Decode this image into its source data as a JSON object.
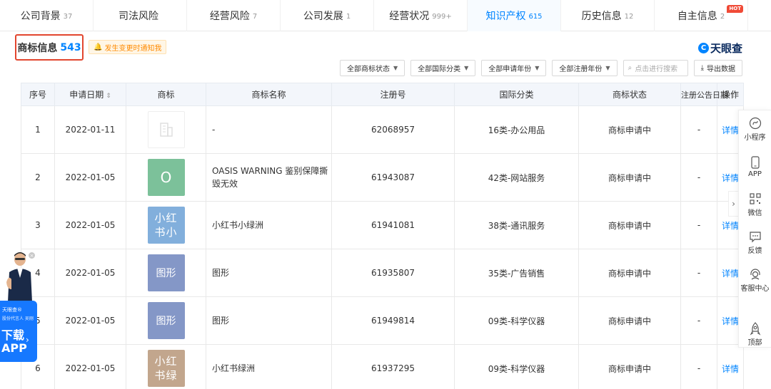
{
  "tabs": [
    {
      "label": "公司背景",
      "count": "37",
      "active": false
    },
    {
      "label": "司法风险",
      "count": "",
      "active": false
    },
    {
      "label": "经营风险",
      "count": "7",
      "active": false
    },
    {
      "label": "公司发展",
      "count": "1",
      "active": false
    },
    {
      "label": "经营状况",
      "count": "999+",
      "active": false
    },
    {
      "label": "知识产权",
      "count": "615",
      "active": true
    },
    {
      "label": "历史信息",
      "count": "12",
      "active": false
    },
    {
      "label": "自主信息",
      "count": "2",
      "active": false,
      "badge": "HOT"
    }
  ],
  "section": {
    "title": "商标信息",
    "count": "543",
    "notify": "发生变更时通知我",
    "logo": "天眼查"
  },
  "filters": {
    "status": "全部商标状态",
    "intl_class": "全部国际分类",
    "apply_year": "全部申请年份",
    "reg_year": "全部注册年份",
    "search_placeholder": "点击进行搜索",
    "export": "导出数据"
  },
  "table": {
    "headers": [
      "序号",
      "申请日期",
      "商标",
      "商标名称",
      "注册号",
      "国际分类",
      "商标状态",
      "注册公告日期",
      "操作"
    ],
    "rows": [
      {
        "no": "1",
        "date": "2022-01-11",
        "tm_text": "",
        "tm_color": "#ffffff",
        "name": "-",
        "reg_no": "62068957",
        "class": "16类-办公用品",
        "status": "商标申请中",
        "pub_date": "-",
        "op": "详情"
      },
      {
        "no": "2",
        "date": "2022-01-05",
        "tm_text": "O",
        "tm_color": "#7cc19a",
        "name": "OASIS WARNING 鉴别保障撕毁无效",
        "reg_no": "61943087",
        "class": "42类-网站服务",
        "status": "商标申请中",
        "pub_date": "-",
        "op": "详情"
      },
      {
        "no": "3",
        "date": "2022-01-05",
        "tm_text": "小红书小",
        "tm_color": "#82afdc",
        "name": "小红书小绿洲",
        "reg_no": "61941081",
        "class": "38类-通讯服务",
        "status": "商标申请中",
        "pub_date": "-",
        "op": "详情"
      },
      {
        "no": "4",
        "date": "2022-01-05",
        "tm_text": "图形",
        "tm_color": "#8497c7",
        "name": "图形",
        "reg_no": "61935807",
        "class": "35类-广告销售",
        "status": "商标申请中",
        "pub_date": "-",
        "op": "详情"
      },
      {
        "no": "5",
        "date": "2022-01-05",
        "tm_text": "图形",
        "tm_color": "#8497c7",
        "name": "图形",
        "reg_no": "61949814",
        "class": "09类-科学仪器",
        "status": "商标申请中",
        "pub_date": "-",
        "op": "详情"
      },
      {
        "no": "6",
        "date": "2022-01-05",
        "tm_text": "小红书绿",
        "tm_color": "#c2a68d",
        "name": "小红书绿洲",
        "reg_no": "61937295",
        "class": "09类-科学仪器",
        "status": "商标申请中",
        "pub_date": "-",
        "op": "详情"
      }
    ]
  },
  "sidebar": [
    {
      "icon": "mini-program-icon",
      "label": "小程序"
    },
    {
      "icon": "phone-icon",
      "label": "APP"
    },
    {
      "icon": "qrcode-icon",
      "label": "微信"
    },
    {
      "icon": "feedback-icon",
      "label": "反馈"
    },
    {
      "icon": "customer-service-icon",
      "label": "客服中心"
    },
    {
      "icon": "rocket-icon",
      "label": "顶部"
    }
  ],
  "promo": {
    "brand": "天眼查®",
    "sub": "股份代言人 吴刚",
    "line1": "下载",
    "line2": "APP"
  },
  "colors": {
    "accent": "#0084ff",
    "highlight_border": "#e2462f",
    "hot_badge": "#f04a36",
    "notify_text": "#ff8a00"
  }
}
